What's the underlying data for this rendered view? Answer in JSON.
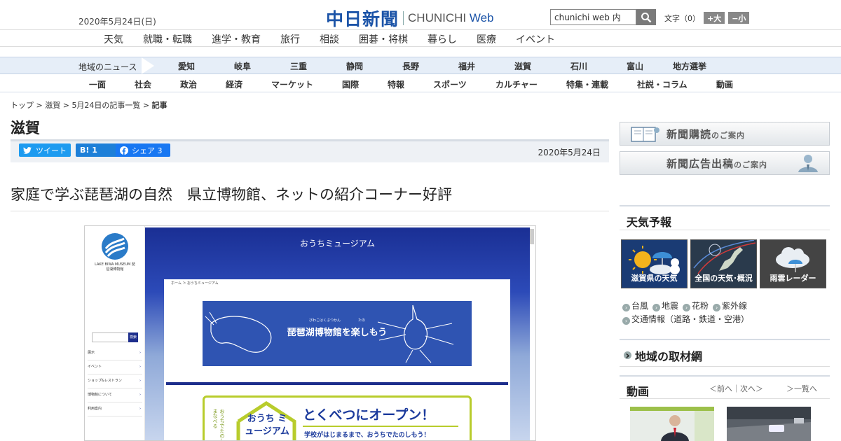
{
  "header": {
    "date": "2020年5月24日(日)",
    "logo_jp": "中日新聞",
    "logo_en": "CHUNICHI",
    "logo_web": "Web",
    "search_value": "chunichi web 内",
    "font_label": "文字（0）",
    "font_bigger": "+大",
    "font_smaller": "−小"
  },
  "categories": [
    "天気",
    "就職・転職",
    "進学・教育",
    "旅行",
    "相談",
    "囲碁・将棋",
    "暮らし",
    "医療",
    "イベント"
  ],
  "region_nav": {
    "label": "地域のニュース",
    "items": [
      "愛知",
      "岐阜",
      "三重",
      "静岡",
      "長野",
      "福井",
      "滋賀",
      "石川",
      "富山",
      "地方選挙"
    ]
  },
  "genre_nav": [
    "一面",
    "社会",
    "政治",
    "経済",
    "マーケット",
    "国際",
    "特報",
    "スポーツ",
    "カルチャー",
    "特集・連載",
    "社説・コラム",
    "動画"
  ],
  "breadcrumb": {
    "items": [
      "トップ",
      "滋賀",
      "5月24日の記事一覧"
    ],
    "current": "記事",
    "separator": " > "
  },
  "page_title": "滋賀",
  "share": {
    "tweet": "ツイート",
    "hatena": "B! 1",
    "facebook": "シェア 3",
    "date": "2020年5月24日"
  },
  "headline": "家庭で学ぶ琵琶湖の自然　県立博物館、ネットの紹介コーナー好評",
  "screenshot": {
    "museum_logo": "LAKE BIWA MUSEUM 琵琶湖博物館",
    "search_go": "検索",
    "side_nav": [
      "展示",
      "イベント",
      "ショップ&レストラン",
      "博物館について",
      "利用案内"
    ],
    "title": "おうちミュージアム",
    "crumb": "ホーム ＞ おうちミュージアム",
    "banner_ruby": "びわこはくぶつかん　　　　　たの",
    "banner_text": "琵琶湖博物館を楽しもう",
    "card_vertical": "おうちでたのしくまなべる",
    "card_hex": "おうち ミュージアム",
    "card_open": "とくべつにオープン！",
    "card_sub": "学校がはじまるまで、おうちでたのしもう！"
  },
  "sidebar": {
    "ad1_main": "新聞購読",
    "ad1_small": "のご案内",
    "ad2_main": "新聞広告出稿",
    "ad2_small": "のご案内",
    "weather_title": "天気予報",
    "tiles": [
      "滋賀県の天気",
      "全国の天気･概況",
      "雨雲レーダー"
    ],
    "links_row1": [
      "台風",
      "地震",
      "花粉",
      "紫外線"
    ],
    "links_row2": "交通情報（道路・鉄道・空港）",
    "region_title": "地域の取材網",
    "video_title": "動画",
    "video_nav": "＜前へ｜次へ＞",
    "video_all": "＞一覧へ"
  },
  "colors": {
    "brand": "#1c54a8",
    "twitter": "#1d9bf0",
    "facebook": "#1877f2",
    "region_bg": "#e6eef8"
  }
}
